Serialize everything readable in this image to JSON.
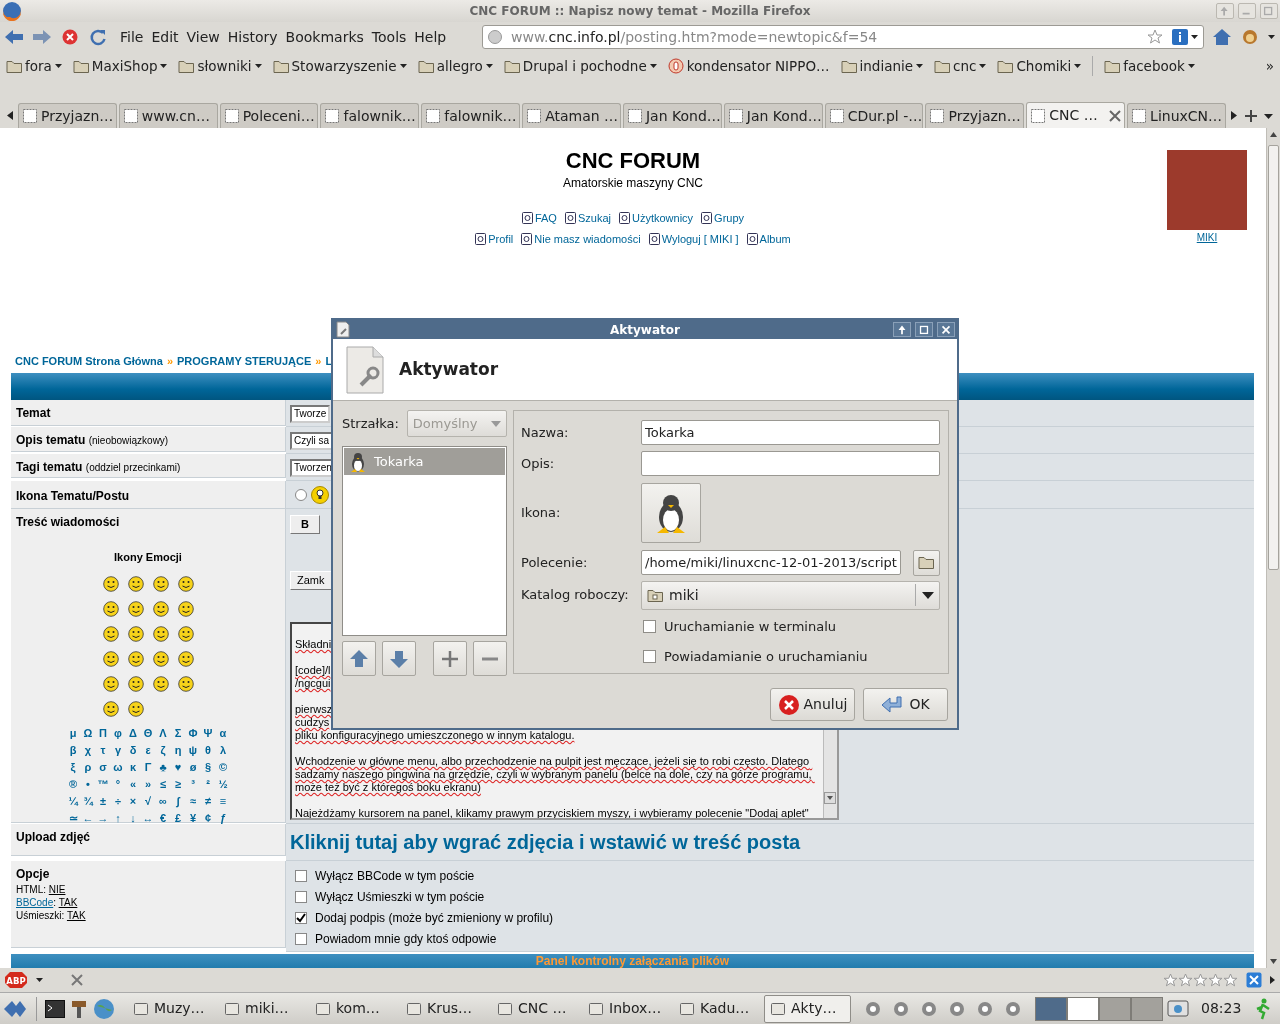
{
  "window": {
    "title": "CNC FORUM :: Napisz nowy temat - Mozilla Firefox"
  },
  "menu": [
    "File",
    "Edit",
    "View",
    "History",
    "Bookmarks",
    "Tools",
    "Help"
  ],
  "address": {
    "prefix": "www.",
    "host": "cnc.info.pl",
    "path": "/posting.htm?mode=newtopic&f=54"
  },
  "bookmarks": [
    {
      "label": "fora",
      "kind": "folder"
    },
    {
      "label": "MaxiShop",
      "kind": "folder"
    },
    {
      "label": "słowniki",
      "kind": "folder"
    },
    {
      "label": "Stowarzyszenie",
      "kind": "folder"
    },
    {
      "label": "allegro",
      "kind": "folder"
    },
    {
      "label": "Drupal i pochodne",
      "kind": "folder"
    },
    {
      "label": "kondensator NIPPO…",
      "kind": "page"
    },
    {
      "label": "indianie",
      "kind": "folder"
    },
    {
      "label": "cnc",
      "kind": "folder"
    },
    {
      "label": "Chomiki",
      "kind": "folder"
    },
    {
      "label": "facebook",
      "kind": "folder"
    }
  ],
  "bookmarks_more": "»",
  "tabs": [
    {
      "label": "Przyjazn…",
      "selected": false
    },
    {
      "label": "www.cn…",
      "selected": false
    },
    {
      "label": "Poleceni…",
      "selected": false
    },
    {
      "label": "falownik…",
      "selected": false
    },
    {
      "label": "falownik…",
      "selected": false
    },
    {
      "label": "Ataman …",
      "selected": false
    },
    {
      "label": "Jan Kond…",
      "selected": false
    },
    {
      "label": "Jan Kond…",
      "selected": false
    },
    {
      "label": "CDur.pl -…",
      "selected": false
    },
    {
      "label": "Przyjazn…",
      "selected": false
    },
    {
      "label": "CNC …",
      "selected": true
    },
    {
      "label": "LinuxCN…",
      "selected": false
    }
  ],
  "forum": {
    "title": "CNC FORUM",
    "subtitle": "Amatorskie maszyny CNC",
    "nav_links": [
      [
        "FAQ",
        "Szukaj",
        "Użytkownicy",
        "Grupy"
      ],
      [
        "Profil",
        "Nie masz wiadomości",
        "Wyloguj [ MIKI ]",
        "Album"
      ]
    ],
    "user": "MIKI",
    "breadcrumb": [
      {
        "kind": "link",
        "text": "CNC FORUM Strona Główna"
      },
      {
        "kind": "separator",
        "text": "»"
      },
      {
        "kind": "link",
        "text": "PROGRAMY STERUJĄCE"
      },
      {
        "kind": "separator",
        "text": "»"
      },
      {
        "kind": "link",
        "text": "L"
      }
    ],
    "fields": [
      {
        "label": "Temat",
        "value": "Tworze"
      },
      {
        "label": "Opis tematu",
        "note": "(nieobowiązkowy)",
        "value": "Czyli sa"
      },
      {
        "label": "Tagi tematu",
        "note": "(oddziel przecinkami)",
        "value": "Tworzen"
      }
    ],
    "icon_row": {
      "label": "Ikona Tematu/Postu",
      "selected": false
    },
    "message": {
      "label": "Treść wiadomości",
      "bold_button": "B",
      "close_button": "Zamk",
      "emoticons_title": "Ikony Emocji",
      "symbols": [
        [
          "μ",
          "Ω",
          "Π",
          "φ",
          "Δ",
          "Θ",
          "Λ",
          "Σ",
          "Φ",
          "Ψ",
          "α"
        ],
        [
          "β",
          "χ",
          "τ",
          "γ",
          "δ",
          "ε",
          "ζ",
          "η",
          "ψ",
          "θ",
          "λ"
        ],
        [
          "ξ",
          "ρ",
          "σ",
          "ω",
          "κ",
          "Γ",
          "♣",
          "♥",
          "ø",
          "§",
          "©"
        ],
        [
          "®",
          "•",
          "™",
          "°",
          "«",
          "»",
          "≤",
          "≥",
          "³",
          "²",
          "½"
        ],
        [
          "¼",
          "¾",
          "±",
          "÷",
          "×",
          "√",
          "∞",
          "∫",
          "≈",
          "≠",
          "≡"
        ],
        [
          "≃",
          "←",
          "→",
          "↑",
          "↓",
          "↔",
          "€",
          "£",
          "¥",
          "¢",
          "ƒ"
        ]
      ],
      "paragraphs": [
        [
          "Składni"
        ],
        [
          "[code]/l",
          "/ngcgui"
        ],
        [
          "pierwsz",
          "cudzys",
          "pliku konfiguracyjnego umieszczonego w innym katalogu."
        ],
        [
          "Wchodzenie w główne menu, albo przechodzenie na pulpit jest męczące, jeżeli się to robi często. Dlatego sadzamy naszego pingwina na grzędzie, czyli w wybranym panelu (belce na dole, czy na górze programu, może też być z któregoś boku ekranu)"
        ],
        [
          "Najeżdżamy kursorem na panel, klikamy prawym przyciskiem myszy, i wybieramy polecenie \"Dodaj aplet\""
        ]
      ]
    },
    "upload": {
      "label": "Upload zdjęć",
      "link": "Kliknij tutaj aby wgrać zdjęcia i wstawić w treść posta"
    },
    "options": {
      "label": "Opcje",
      "settings": [
        [
          {
            "text": "HTML: ",
            "link": false
          },
          {
            "text": "NIE",
            "link": true
          }
        ],
        [
          {
            "text": "BBCode",
            "link": true
          },
          {
            "text": ": ",
            "link": false
          },
          {
            "text": "TAK",
            "link": true
          }
        ],
        [
          {
            "text": "Uśmieszki: ",
            "link": false
          },
          {
            "text": "TAK",
            "link": true
          }
        ]
      ],
      "checkboxes": [
        {
          "label": "Wyłącz BBCode w tym poście",
          "checked": false
        },
        {
          "label": "Wyłącz Uśmieszki w tym poście",
          "checked": false
        },
        {
          "label": "Dodaj podpis (może być zmieniony w profilu)",
          "checked": true
        },
        {
          "label": "Powiadom mnie gdy ktoś odpowie",
          "checked": false
        }
      ]
    },
    "footer_bar": "Panel kontrolny załączania plików"
  },
  "dialog": {
    "title": "Aktywator",
    "heading": "Aktywator",
    "arrow": {
      "label": "Strzałka:",
      "value": "Domyślny",
      "disabled": true
    },
    "items": [
      {
        "label": "Tokarka",
        "selected": true
      }
    ],
    "fields": [
      {
        "kind": "text",
        "label": "Nazwa:",
        "value": "Tokarka"
      },
      {
        "kind": "text",
        "label": "Opis:"
      },
      {
        "kind": "icon",
        "label": "Ikona:"
      },
      {
        "kind": "command",
        "label": "Polecenie:",
        "value": "/home/miki/linuxcnc-12-01-2013/script"
      },
      {
        "kind": "folder",
        "label": "Katalog roboczy:",
        "value": "miki"
      }
    ],
    "checkboxes": [
      {
        "label": "Uruchamianie w terminalu",
        "checked": false
      },
      {
        "label": "Powiadamianie o uruchamianiu",
        "checked": false
      }
    ],
    "buttons": [
      {
        "kind": "cancel",
        "label": "Anuluj"
      },
      {
        "kind": "ok",
        "label": "OK"
      }
    ]
  },
  "addon_bar": {
    "adblock": "ABP",
    "stars": 0
  },
  "taskbar": {
    "tasks": [
      {
        "label": "Muzy…",
        "selected": false
      },
      {
        "label": "miki…",
        "selected": false
      },
      {
        "label": "kom…",
        "selected": false
      },
      {
        "label": "Krus…",
        "selected": false
      },
      {
        "label": "CNC …",
        "selected": false
      },
      {
        "label": "Inbox…",
        "selected": false
      },
      {
        "label": "Kadu…",
        "selected": false
      },
      {
        "label": "Akty…",
        "selected": true
      }
    ],
    "clock": "08:23"
  }
}
